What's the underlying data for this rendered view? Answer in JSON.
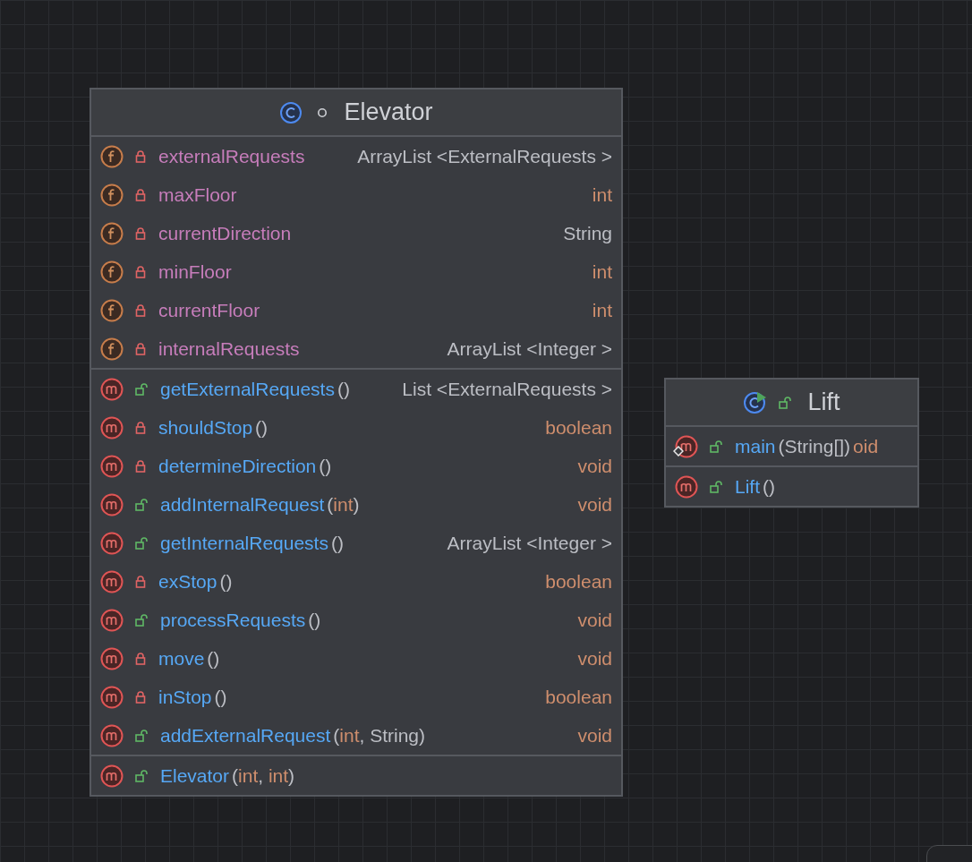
{
  "classes": [
    {
      "name": "Elevator",
      "kind": "class",
      "public": false,
      "sections": [
        [
          {
            "kind": "field",
            "public": false,
            "name": "externalRequests",
            "type": "ArrayList <ExternalRequests >",
            "primitive": false
          },
          {
            "kind": "field",
            "public": false,
            "name": "maxFloor",
            "type": "int",
            "primitive": true
          },
          {
            "kind": "field",
            "public": false,
            "name": "currentDirection",
            "type": "String",
            "primitive": false
          },
          {
            "kind": "field",
            "public": false,
            "name": "minFloor",
            "type": "int",
            "primitive": true
          },
          {
            "kind": "field",
            "public": false,
            "name": "currentFloor",
            "type": "int",
            "primitive": true
          },
          {
            "kind": "field",
            "public": false,
            "name": "internalRequests",
            "type": "ArrayList <Integer >",
            "primitive": false
          }
        ],
        [
          {
            "kind": "method",
            "public": true,
            "name": "getExternalRequests",
            "params": [
              {
                "text": "()",
                "primitive": false
              }
            ],
            "type": "List <ExternalRequests >",
            "primitive": false
          },
          {
            "kind": "method",
            "public": false,
            "name": "shouldStop",
            "params": [
              {
                "text": "()",
                "primitive": false
              }
            ],
            "type": "boolean",
            "primitive": true
          },
          {
            "kind": "method",
            "public": false,
            "name": "determineDirection",
            "params": [
              {
                "text": "()",
                "primitive": false
              }
            ],
            "type": "void",
            "primitive": true
          },
          {
            "kind": "method",
            "public": true,
            "name": "addInternalRequest",
            "params": [
              {
                "text": "(",
                "primitive": false
              },
              {
                "text": "int",
                "primitive": true
              },
              {
                "text": ")",
                "primitive": false
              }
            ],
            "type": "void",
            "primitive": true
          },
          {
            "kind": "method",
            "public": true,
            "name": "getInternalRequests",
            "params": [
              {
                "text": "()",
                "primitive": false
              }
            ],
            "type": "ArrayList <Integer >",
            "primitive": false
          },
          {
            "kind": "method",
            "public": false,
            "name": "exStop",
            "params": [
              {
                "text": "()",
                "primitive": false
              }
            ],
            "type": "boolean",
            "primitive": true
          },
          {
            "kind": "method",
            "public": true,
            "name": "processRequests",
            "params": [
              {
                "text": "()",
                "primitive": false
              }
            ],
            "type": "void",
            "primitive": true
          },
          {
            "kind": "method",
            "public": false,
            "name": "move",
            "params": [
              {
                "text": "()",
                "primitive": false
              }
            ],
            "type": "void",
            "primitive": true
          },
          {
            "kind": "method",
            "public": false,
            "name": "inStop",
            "params": [
              {
                "text": "()",
                "primitive": false
              }
            ],
            "type": "boolean",
            "primitive": true
          },
          {
            "kind": "method",
            "public": true,
            "name": "addExternalRequest",
            "params": [
              {
                "text": "(",
                "primitive": false
              },
              {
                "text": "int",
                "primitive": true
              },
              {
                "text": ", ",
                "primitive": false
              },
              {
                "text": "String",
                "primitive": false
              },
              {
                "text": ")",
                "primitive": false
              }
            ],
            "type": "void",
            "primitive": true
          }
        ],
        [
          {
            "kind": "method",
            "public": true,
            "name": "Elevator",
            "params": [
              {
                "text": "(",
                "primitive": false
              },
              {
                "text": "int",
                "primitive": true
              },
              {
                "text": ", ",
                "primitive": false
              },
              {
                "text": "int",
                "primitive": true
              },
              {
                "text": ")",
                "primitive": false
              }
            ]
          }
        ]
      ]
    },
    {
      "name": "Lift",
      "kind": "main_class",
      "public": true,
      "sections": [
        [
          {
            "kind": "method",
            "public": true,
            "name": "main",
            "marked": true,
            "params": [
              {
                "text": "(",
                "primitive": false
              },
              {
                "text": "String[]",
                "primitive": false
              },
              {
                "text": ")",
                "primitive": false
              }
            ],
            "type": "oid",
            "primitive": true
          }
        ],
        [
          {
            "kind": "method",
            "public": true,
            "name": "Lift",
            "params": [
              {
                "text": "()",
                "primitive": false
              }
            ]
          }
        ]
      ]
    }
  ]
}
